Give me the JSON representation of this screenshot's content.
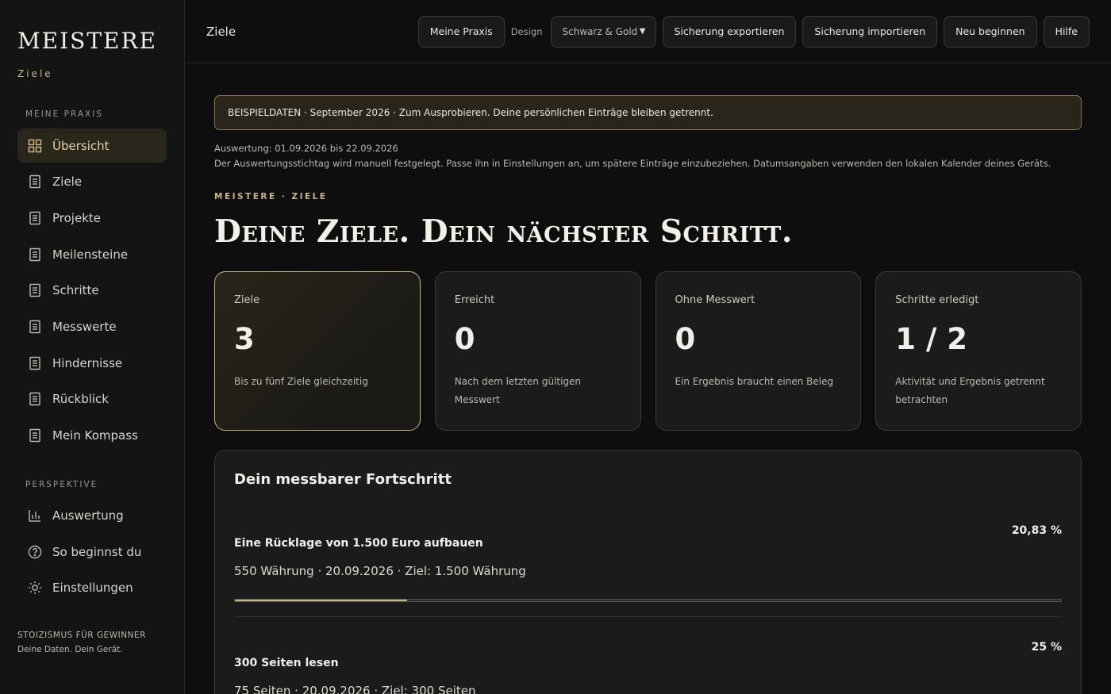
{
  "brand": {
    "name": "MEISTERE",
    "subtitle": "Ziele"
  },
  "sidebar": {
    "section1": "MEINE PRAXIS",
    "items": [
      {
        "label": "Übersicht",
        "icon": "grid-icon",
        "active": true
      },
      {
        "label": "Ziele",
        "icon": "document-icon"
      },
      {
        "label": "Projekte",
        "icon": "document-icon"
      },
      {
        "label": "Meilensteine",
        "icon": "document-icon"
      },
      {
        "label": "Schritte",
        "icon": "document-icon"
      },
      {
        "label": "Messwerte",
        "icon": "document-icon"
      },
      {
        "label": "Hindernisse",
        "icon": "document-icon"
      },
      {
        "label": "Rückblick",
        "icon": "document-icon"
      },
      {
        "label": "Mein Kompass",
        "icon": "document-icon"
      }
    ],
    "section2": "PERSPEKTIVE",
    "items2": [
      {
        "label": "Auswertung",
        "icon": "bar-chart-icon"
      },
      {
        "label": "So beginnst du",
        "icon": "help-circle-icon"
      },
      {
        "label": "Einstellungen",
        "icon": "sun-icon"
      }
    ],
    "footer": {
      "line1": "STOIZISMUS FÜR GEWINNER",
      "line2": "Deine Daten. Dein Gerät."
    }
  },
  "topbar": {
    "title": "Ziele",
    "btn_praxis": "Meine Praxis",
    "design_label": "Design",
    "design_value": "Schwarz & Gold",
    "btn_export": "Sicherung exportieren",
    "btn_import": "Sicherung importieren",
    "btn_reset": "Neu beginnen",
    "btn_help": "Hilfe"
  },
  "notice": "BEISPIELDATEN · September 2026 · Zum Ausprobieren. Deine persönlichen Einträge bleiben getrennt.",
  "meta": {
    "range": "Auswertung: 01.09.2026 bis 22.09.2026",
    "note": "Der Auswertungsstichtag wird manuell festgelegt. Passe ihn in Einstellungen an, um spätere Einträge einzubeziehen. Datumsangaben verwenden den lokalen Kalender deines Geräts."
  },
  "kicker": "MEISTERE · ZIELE",
  "headline": "Deine Ziele. Dein nächster Schritt.",
  "cards": [
    {
      "label": "Ziele",
      "value": "3",
      "desc": "Bis zu fünf Ziele gleichzeitig"
    },
    {
      "label": "Erreicht",
      "value": "0",
      "desc": "Nach dem letzten gültigen Messwert"
    },
    {
      "label": "Ohne Messwert",
      "value": "0",
      "desc": "Ein Ergebnis braucht einen Beleg"
    },
    {
      "label": "Schritte erledigt",
      "value": "1 / 2",
      "desc": "Aktivität und Ergebnis getrennt betrachten"
    }
  ],
  "progress": {
    "title": "Dein messbarer Fortschritt",
    "goals": [
      {
        "name": "Eine Rücklage von 1.500 Euro aufbauen",
        "pct_label": "20,83 %",
        "fraction": 0.2083,
        "detail": "550 Währung · 20.09.2026 · Ziel: 1.500 Währung"
      },
      {
        "name": "300 Seiten lesen",
        "pct_label": "25 %",
        "fraction": 0.25,
        "detail": "75 Seiten · 20.09.2026 · Ziel: 300 Seiten"
      }
    ]
  },
  "colors": {
    "accent": "#c9b488",
    "background": "#0e0e0e",
    "panel": "#1b1b1b"
  }
}
